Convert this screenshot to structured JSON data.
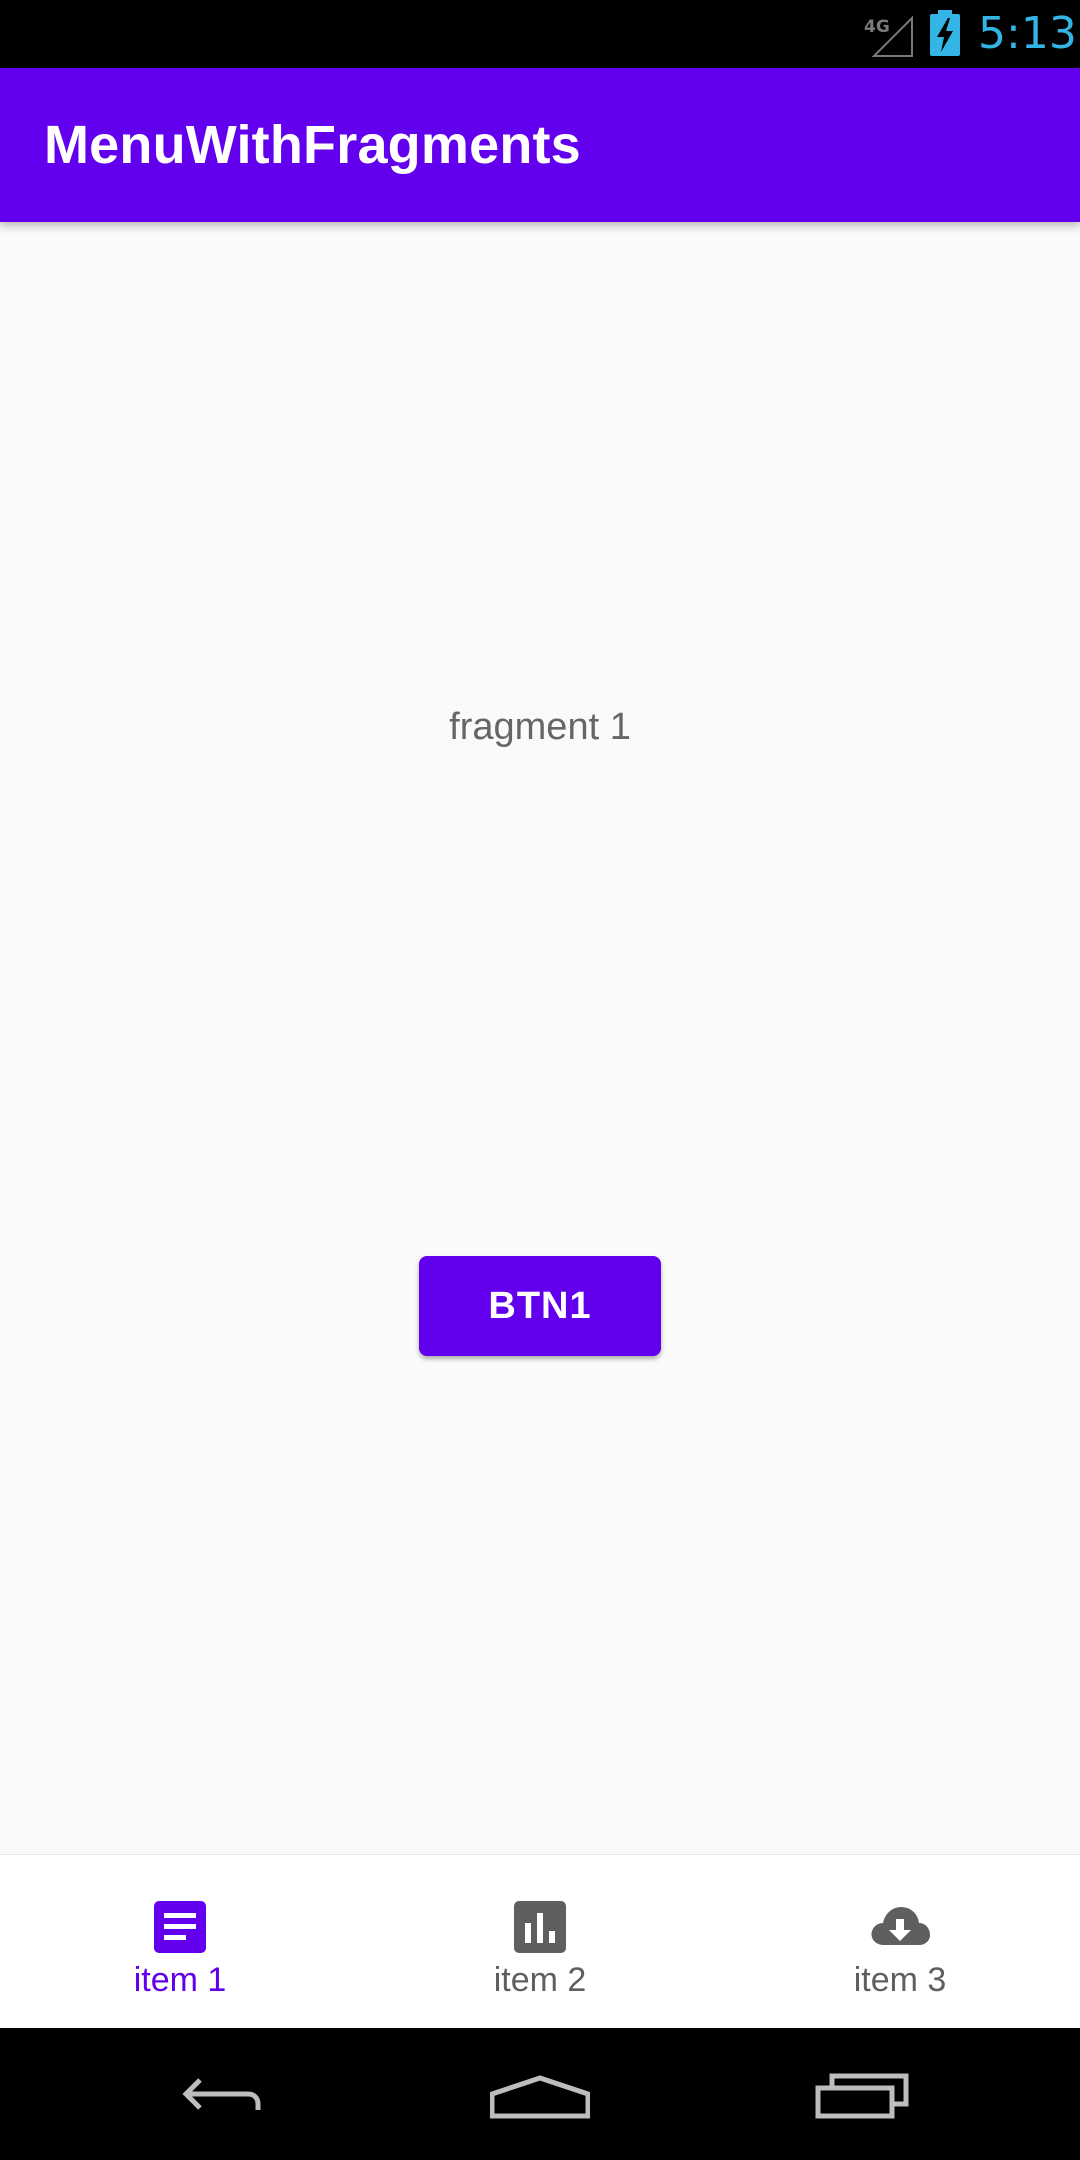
{
  "status_bar": {
    "network_label": "4G",
    "time": "5:13"
  },
  "app_bar": {
    "title": "MenuWithFragments"
  },
  "content": {
    "fragment_text": "fragment 1",
    "button_label": "BTN1"
  },
  "bottom_nav": {
    "items": [
      {
        "label": "item 1",
        "icon": "notes-icon",
        "active": true
      },
      {
        "label": "item 2",
        "icon": "bar-chart-icon",
        "active": false
      },
      {
        "label": "item 3",
        "icon": "cloud-download-icon",
        "active": false
      }
    ]
  },
  "system_nav": {
    "buttons": [
      "back-icon",
      "home-icon",
      "recents-icon"
    ]
  },
  "colors": {
    "primary": "#6200ee",
    "status_time": "#33b5e5",
    "inactive": "#5f5f5f",
    "background": "#fafafa"
  }
}
